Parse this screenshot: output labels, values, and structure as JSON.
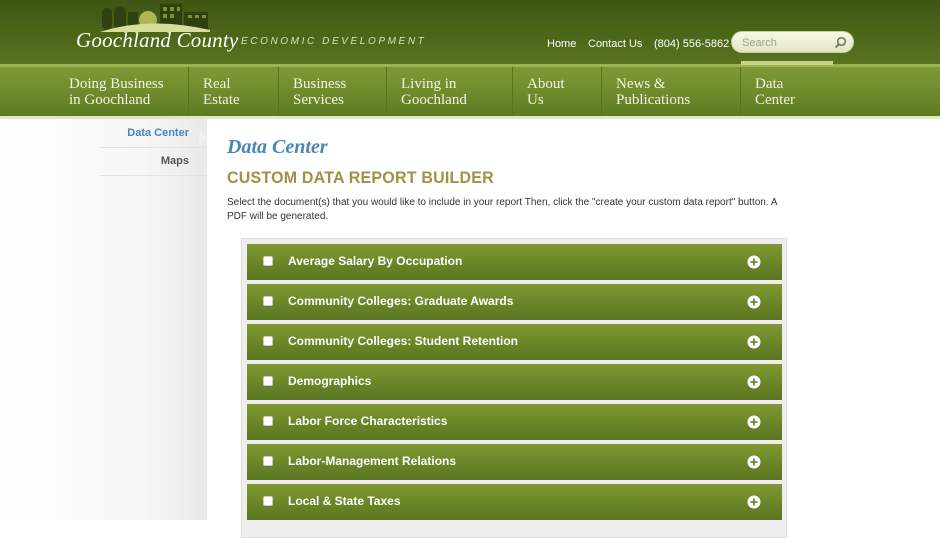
{
  "header": {
    "title": "Goochland County",
    "subtitle": "ECONOMIC DEVELOPMENT",
    "links": {
      "home": "Home",
      "contact": "Contact Us",
      "phone": "(804) 556-5862"
    },
    "search_placeholder": "Search"
  },
  "nav": {
    "items": [
      {
        "line1": "Doing Business",
        "line2": "in Goochland"
      },
      {
        "line1": "Real",
        "line2": "Estate"
      },
      {
        "line1": "Business",
        "line2": "Services"
      },
      {
        "line1": "Living in",
        "line2": "Goochland"
      },
      {
        "line1": "About",
        "line2": "Us"
      },
      {
        "line1": "News &",
        "line2": "Publications"
      },
      {
        "line1": "Data",
        "line2": "Center"
      }
    ],
    "active_index": 6
  },
  "sidebar": {
    "items": [
      {
        "label": "Data Center"
      },
      {
        "label": "Maps"
      }
    ]
  },
  "main": {
    "page_title": "Data Center",
    "section_title": "CUSTOM DATA REPORT BUILDER",
    "instructions": "Select the document(s) that you would like to include in your report Then, click the \"create your custom data report\" button. A PDF will be generated.",
    "reports": [
      {
        "label": "Average Salary By Occupation"
      },
      {
        "label": "Community Colleges: Graduate Awards"
      },
      {
        "label": "Community Colleges: Student Retention"
      },
      {
        "label": "Demographics"
      },
      {
        "label": "Labor Force Characteristics"
      },
      {
        "label": "Labor-Management Relations"
      },
      {
        "label": "Local & State Taxes"
      }
    ]
  },
  "colors": {
    "header_green": "#4c6619",
    "nav_green": "#6f8b2c",
    "link_blue": "#4a86b5",
    "section_gold": "#a49045"
  }
}
